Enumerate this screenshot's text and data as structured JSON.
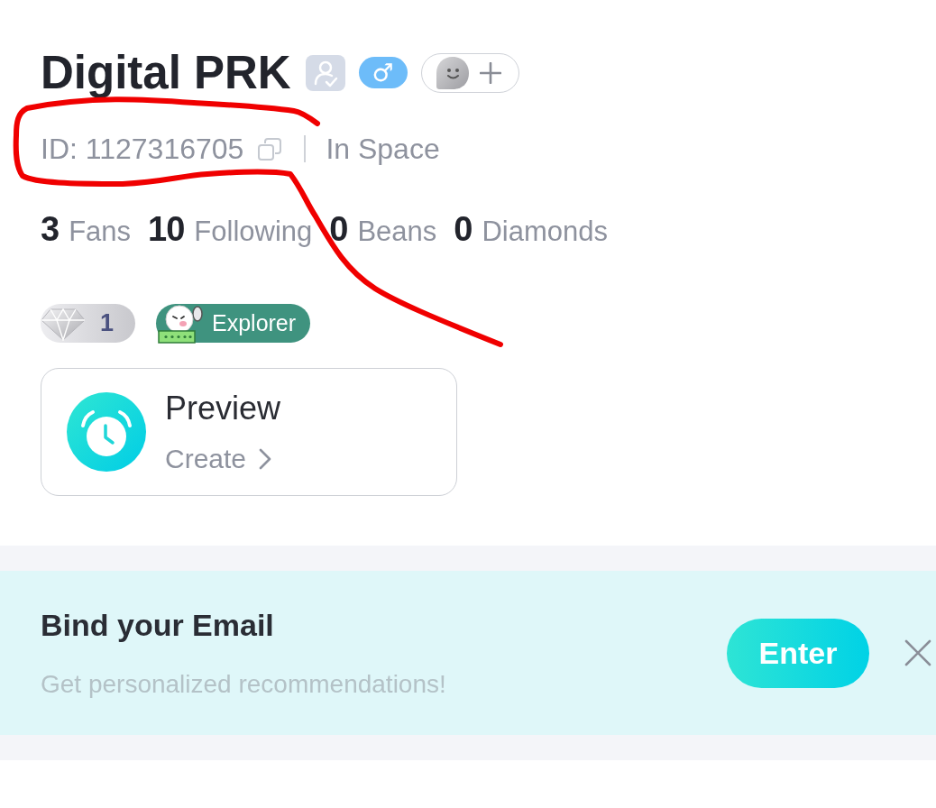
{
  "profile": {
    "name": "Digital PRK",
    "verified": false,
    "gender_symbol": "♂"
  },
  "id_row": {
    "text": "ID: 1127316705",
    "status": "In Space",
    "circled": true
  },
  "stats": [
    {
      "count": "3",
      "label": "Fans"
    },
    {
      "count": "10",
      "label": "Following"
    },
    {
      "count": "0",
      "label": "Beans"
    },
    {
      "count": "0",
      "label": "Diamonds"
    }
  ],
  "badges": [
    {
      "kind": "level",
      "text": "1"
    },
    {
      "kind": "medal",
      "text": "Explorer"
    }
  ],
  "preview_card": {
    "title": "Preview",
    "action": "Create"
  },
  "email_banner": {
    "title": "Bind your Email",
    "subtitle": "Get personalized recommendations!",
    "button": "Enter"
  }
}
